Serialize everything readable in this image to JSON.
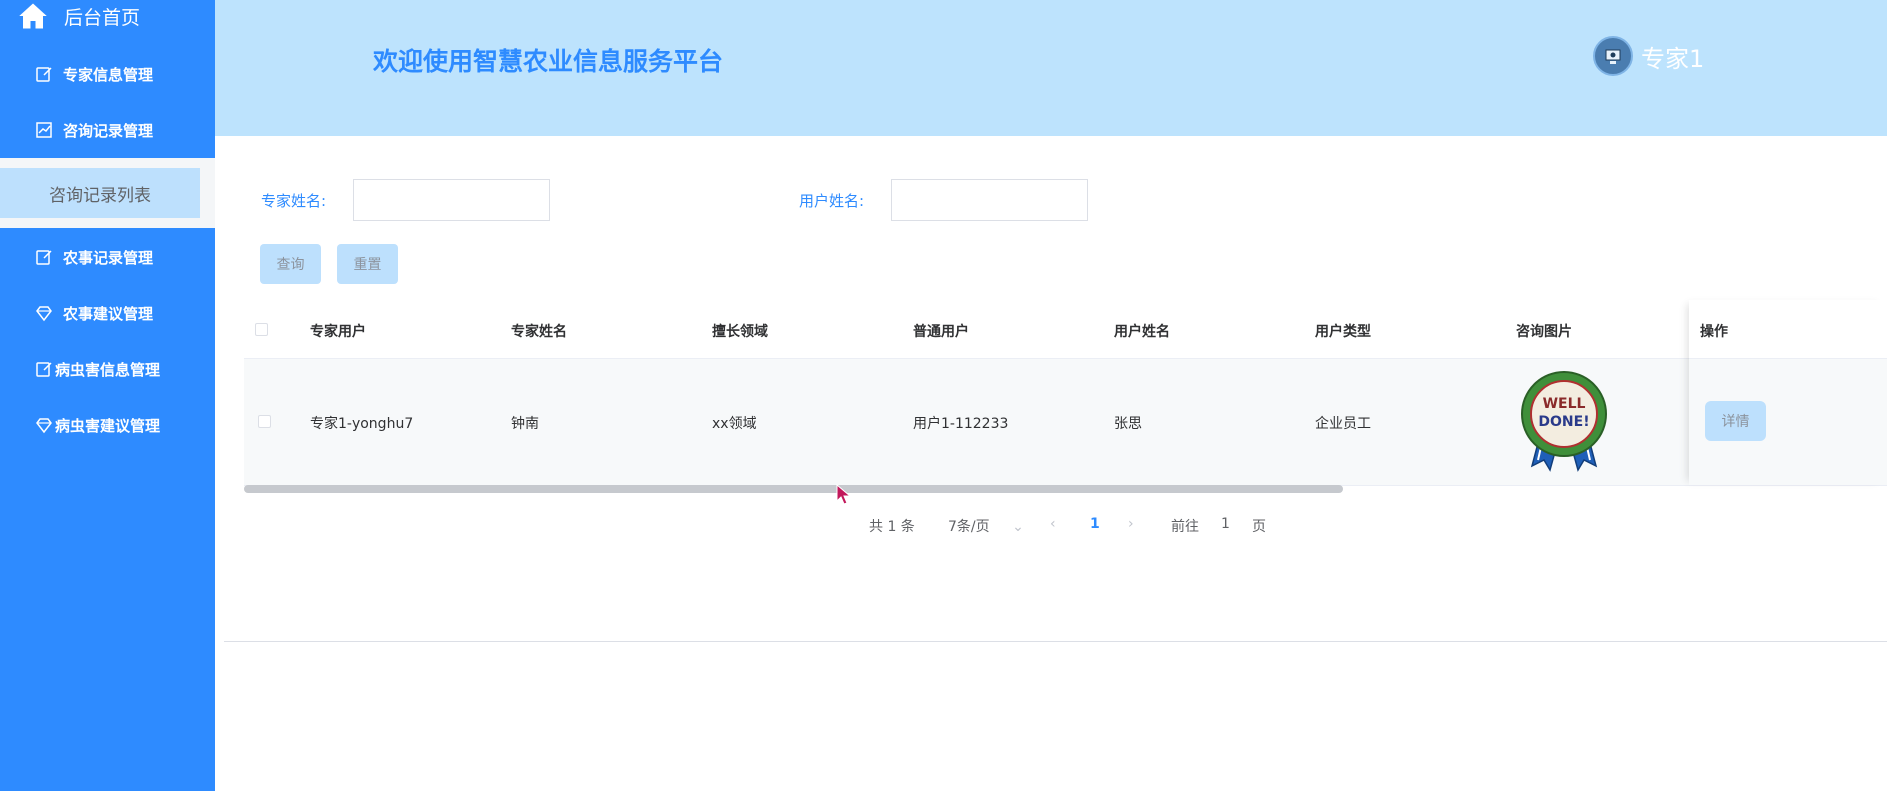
{
  "sidebar": {
    "home_label": "后台首页",
    "items": [
      {
        "label": "专家信息管理",
        "icon": "edit-icon"
      },
      {
        "label": "咨询记录管理",
        "icon": "chart-icon"
      },
      {
        "label": "农事记录管理",
        "icon": "edit-icon"
      },
      {
        "label": "农事建议管理",
        "icon": "gem-icon"
      },
      {
        "label": "病虫害信息管理",
        "icon": "edit-icon"
      },
      {
        "label": "病虫害建议管理",
        "icon": "gem-icon"
      }
    ],
    "active_submenu": "咨询记录列表"
  },
  "header": {
    "title": "欢迎使用智慧农业信息服务平台",
    "username": "专家1"
  },
  "search": {
    "expert_name_label": "专家姓名:",
    "expert_name_value": "",
    "user_name_label": "用户姓名:",
    "user_name_value": "",
    "query_button": "查询",
    "reset_button": "重置"
  },
  "table": {
    "columns": [
      "专家用户",
      "专家姓名",
      "擅长领域",
      "普通用户",
      "用户姓名",
      "用户类型",
      "咨询图片",
      "操作"
    ],
    "rows": [
      {
        "expert_user": "专家1-yonghu7",
        "expert_name": "钟南",
        "field": "xx领域",
        "normal_user": "用户1-112233",
        "user_name": "张思",
        "user_type": "企业员工",
        "image": "well-done-badge",
        "action": "详情"
      }
    ]
  },
  "pagination": {
    "total": "共 1 条",
    "page_size": "7条/页",
    "current_page": "1",
    "goto_label": "前往",
    "goto_value": "1",
    "page_suffix": "页"
  },
  "colors": {
    "sidebar": "#2e8bff",
    "header": "#bde3fd",
    "accent": "#2e8bff",
    "button": "#bde0fd"
  }
}
